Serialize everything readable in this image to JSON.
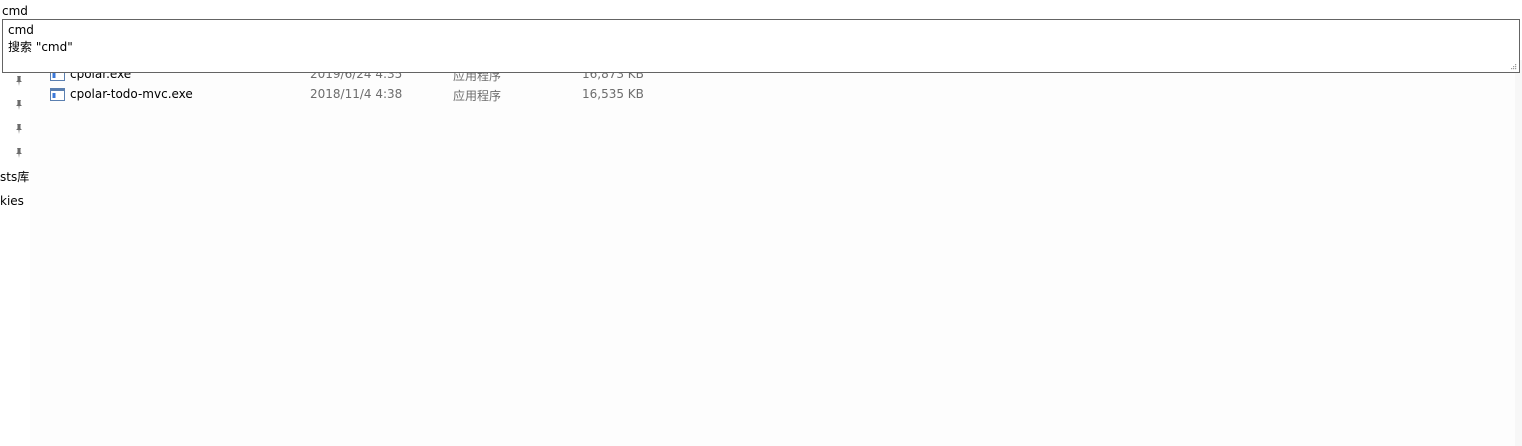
{
  "address_bar": {
    "value": "cmd"
  },
  "suggestions": [
    {
      "label": "cmd"
    },
    {
      "label": "搜索 \"cmd\""
    }
  ],
  "navigation": {
    "pinned_count": 4,
    "labels": [
      "sts库",
      "kies"
    ]
  },
  "file_list": {
    "rows": [
      {
        "name": "cpolar.exe",
        "date": "2019/6/24 4:35",
        "type": "应用程序",
        "size": "16,873 KB",
        "obscured": true
      },
      {
        "name": "cpolar-todo-mvc.exe",
        "date": "2018/11/4 4:38",
        "type": "应用程序",
        "size": "16,535 KB",
        "obscured": false
      }
    ]
  }
}
